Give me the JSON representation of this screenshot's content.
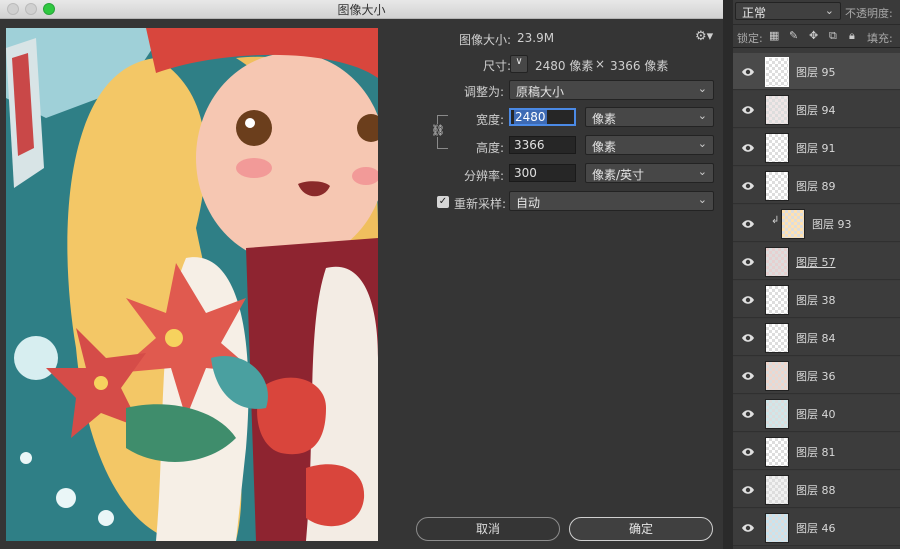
{
  "window": {
    "title": "图像大小"
  },
  "dialog": {
    "image_size_label": "图像大小:",
    "image_size_value": "23.9M",
    "dimensions_label": "尺寸:",
    "dimensions_value": "2480 像素",
    "dimensions_x": "×",
    "dimensions_value2": "3366 像素",
    "fit_to_label": "调整为:",
    "fit_to_value": "原稿大小",
    "width_label": "宽度:",
    "width_value": "2480",
    "width_unit": "像素",
    "height_label": "高度:",
    "height_value": "3366",
    "height_unit": "像素",
    "resolution_label": "分辨率:",
    "resolution_value": "300",
    "resolution_unit": "像素/英寸",
    "resample_label": "重新采样:",
    "resample_value": "自动",
    "resample_checked": true,
    "cancel_label": "取消",
    "ok_label": "确定"
  },
  "layers_panel": {
    "blend_mode": "正常",
    "opacity_label": "不透明度:",
    "lock_label": "锁定:",
    "fill_label": "填充:",
    "layers": [
      {
        "name": "图层 95",
        "selected": true
      },
      {
        "name": "图层 94"
      },
      {
        "name": "图层 91"
      },
      {
        "name": "图层 89"
      },
      {
        "name": "图层 93",
        "clipped": true
      },
      {
        "name": "图层 57",
        "underlined": true
      },
      {
        "name": "图层 38"
      },
      {
        "name": "图层 84"
      },
      {
        "name": "图层 36"
      },
      {
        "name": "图层 40"
      },
      {
        "name": "图层 81"
      },
      {
        "name": "图层 88"
      },
      {
        "name": "图层 46"
      }
    ]
  },
  "colors": {
    "accent": "#4b8ae6",
    "dialog_bg": "#353535",
    "panel_bg": "#3a3a3a"
  }
}
